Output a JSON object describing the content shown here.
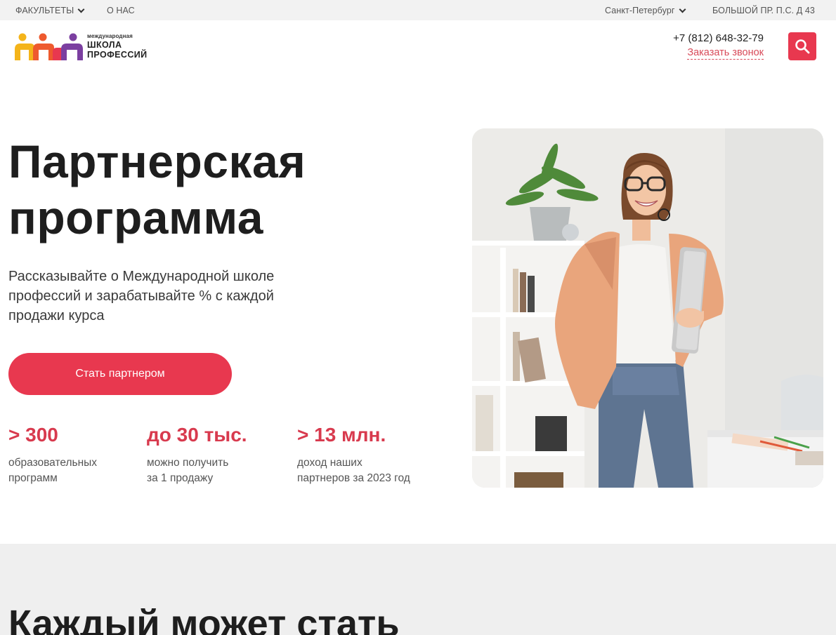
{
  "topbar": {
    "faculties": "ФАКУЛЬТЕТЫ",
    "about": "О НАС",
    "city": "Санкт-Петербург",
    "address": "БОЛЬШОЙ ПР. П.С. Д 43"
  },
  "header": {
    "logo": {
      "small": "международная",
      "line1": "ШКОЛА",
      "line2": "ПРОФЕССИЙ"
    },
    "phone": "+7 (812) 648-32-79",
    "callback": "Заказать звонок"
  },
  "hero": {
    "title_line1": "Партнерская",
    "title_line2": "программа",
    "text": "Рассказывайте о Международной школе профессий и зарабатывайте % с каждой продажи курса",
    "cta": "Стать партнером"
  },
  "stats": [
    {
      "number": "> 300",
      "line1": "образовательных",
      "line2": "программ"
    },
    {
      "number": "до 30 тыс.",
      "line1": "можно получить",
      "line2": "за 1 продажу"
    },
    {
      "number": "> 13 млн.",
      "line1": "доход наших",
      "line2": "партнеров за 2023 год"
    }
  ],
  "section2": {
    "heading": "Каждый может стать"
  },
  "colors": {
    "accent": "#e8384f",
    "stat_number": "#d83a4e",
    "topbar_bg": "#f2f2f2",
    "section_bg": "#efefef"
  },
  "icons": [
    "chevron-down-icon",
    "search-icon"
  ]
}
